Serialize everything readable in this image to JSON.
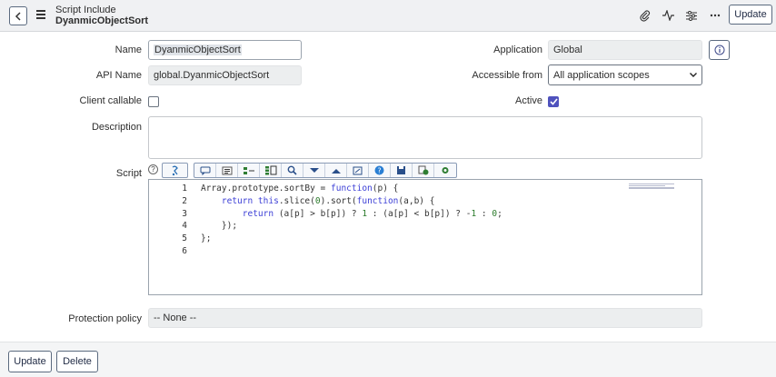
{
  "header": {
    "type_label": "Script Include",
    "record_name": "DyanmicObjectSort",
    "update_label": "Update",
    "icons": [
      "back-icon",
      "hamburger-icon",
      "paperclip-icon",
      "activity-icon",
      "settings-sliders-icon",
      "more-icon"
    ]
  },
  "form": {
    "name_label": "Name",
    "name_value": "DyanmicObjectSort",
    "api_name_label": "API Name",
    "api_name_value": "global.DyanmicObjectSort",
    "client_callable_label": "Client callable",
    "client_callable_checked": false,
    "description_label": "Description",
    "description_value": "",
    "script_label": "Script",
    "application_label": "Application",
    "application_value": "Global",
    "accessible_from_label": "Accessible from",
    "accessible_from_value": "All application scopes",
    "active_label": "Active",
    "active_checked": true,
    "protection_policy_label": "Protection policy",
    "protection_policy_value": "-- None --"
  },
  "editor": {
    "line_numbers": [
      "1",
      "2",
      "3",
      "4",
      "5",
      "6"
    ],
    "toolbar_icons": [
      "script-help-icon",
      "comment-icon",
      "format-icon",
      "replace-icon",
      "replace-all-icon",
      "search-icon",
      "toggle-down-icon",
      "toggle-up-icon",
      "fullscreen-icon",
      "help-icon",
      "save-icon",
      "syntax-check-icon",
      "debug-icon"
    ]
  },
  "footer": {
    "update_label": "Update",
    "delete_label": "Delete"
  },
  "colors": {
    "accent": "#4f52bd",
    "header_bg": "#f0f1f3",
    "keyword": "#3c3fd6"
  }
}
